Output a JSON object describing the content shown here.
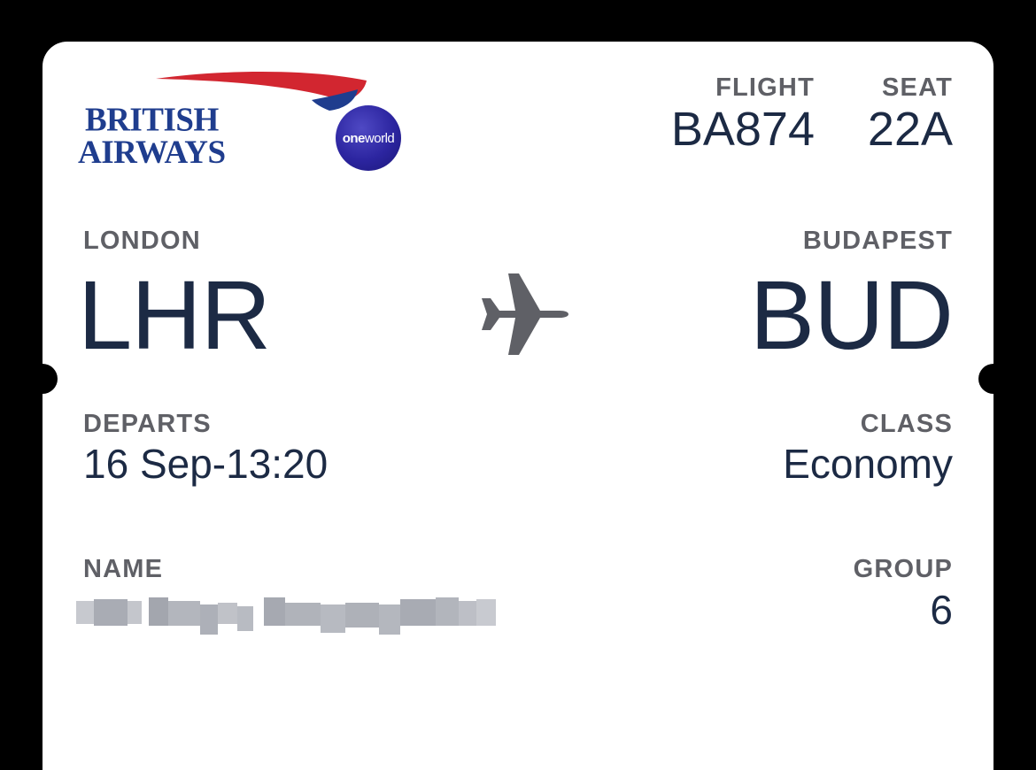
{
  "airline": {
    "name_line1": "BRITISH",
    "name_line2": "AIRWAYS",
    "alliance_bold": "one",
    "alliance_light": "world"
  },
  "flight": {
    "label": "FLIGHT",
    "value": "BA874"
  },
  "seat": {
    "label": "SEAT",
    "value": "22A"
  },
  "origin": {
    "city": "LONDON",
    "code": "LHR"
  },
  "destination": {
    "city": "BUDAPEST",
    "code": "BUD"
  },
  "departs": {
    "label": "DEPARTS",
    "value": "16 Sep-13:20"
  },
  "class": {
    "label": "CLASS",
    "value": "Economy"
  },
  "passenger": {
    "label": "NAME"
  },
  "group": {
    "label": "GROUP",
    "value": "6"
  },
  "icons": {
    "route": "airplane-icon",
    "logo_mark": "speedmarque-icon",
    "alliance": "oneworld-icon"
  },
  "colors": {
    "brand_blue": "#1f3d8e",
    "brand_red": "#d22630",
    "text_dark": "#1c2a44",
    "label_gray": "#5f6066",
    "alliance_purple": "#2c25a0"
  }
}
